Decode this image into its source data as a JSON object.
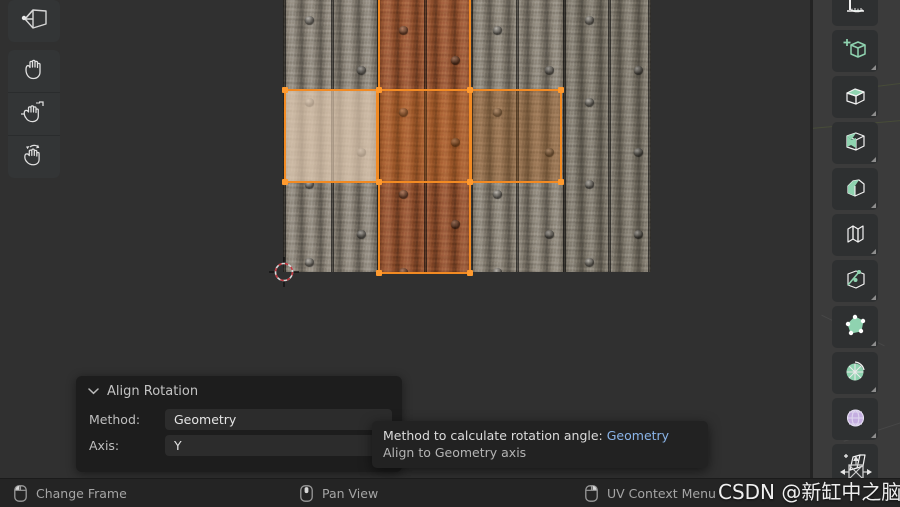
{
  "app": {
    "editor": "uv-editor",
    "background_color": "#303030",
    "accent_color": "#f28a22"
  },
  "left_toolbar": {
    "tools": [
      {
        "name": "tweak-tool",
        "label": "Tweak"
      },
      {
        "name": "cursor-tool",
        "label": "Cursor"
      },
      {
        "name": "move-tool",
        "label": "Move"
      },
      {
        "name": "rotate-tool",
        "label": "Rotate"
      }
    ]
  },
  "right_toolbar": {
    "tools": [
      {
        "name": "measure-tool",
        "label": "Measure"
      },
      {
        "name": "add-cube-tool",
        "label": "Add Cube"
      },
      {
        "name": "extrude-region-tool",
        "label": "Extrude Region"
      },
      {
        "name": "inset-faces-tool",
        "label": "Inset Faces"
      },
      {
        "name": "bevel-tool",
        "label": "Bevel"
      },
      {
        "name": "loop-cut-tool",
        "label": "Loop Cut"
      },
      {
        "name": "knife-tool",
        "label": "Knife"
      },
      {
        "name": "poly-build-tool",
        "label": "Poly Build"
      },
      {
        "name": "spin-tool",
        "label": "Spin"
      },
      {
        "name": "smooth-tool",
        "label": "Smooth"
      },
      {
        "name": "shear-tool",
        "label": "Shear"
      }
    ],
    "gizmo": {
      "name": "transform-gizmo",
      "label": "Transform"
    }
  },
  "operator_panel": {
    "title": "Align Rotation",
    "collapse_icon": "chevron-down-icon",
    "rows": [
      {
        "label": "Method:",
        "value": "Geometry",
        "name": "method"
      },
      {
        "label": "Axis:",
        "value": "Y",
        "name": "axis"
      }
    ]
  },
  "tooltip": {
    "description": "Method to calculate rotation angle:",
    "value": "Geometry",
    "detail": "Align to Geometry axis",
    "value_color": "#8ab4e8"
  },
  "statusbar": {
    "items": [
      {
        "icon": "mouse-left-click-icon",
        "label": "Change Frame",
        "button": "left"
      },
      {
        "icon": "mouse-middle-click-icon",
        "label": "Pan View",
        "button": "middle"
      },
      {
        "icon": "mouse-right-click-icon",
        "label": "UV Context Menu",
        "button": "right"
      }
    ]
  },
  "watermark": {
    "text": "CSDN @新缸中之脑"
  },
  "uv_selection": {
    "note": "three selected UV faces forming a horizontal row, plus a vertical column of faces",
    "faces_selected": 3
  }
}
